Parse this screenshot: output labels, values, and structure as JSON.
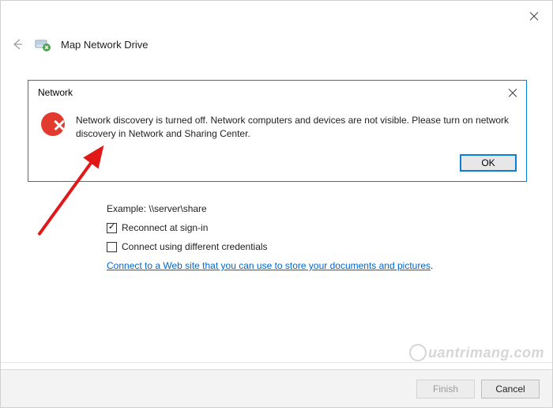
{
  "window": {
    "title": "Map Network Drive"
  },
  "wizard": {
    "example_label": "Example: \\\\server\\share",
    "reconnect_label": "Reconnect at sign-in",
    "reconnect_checked": true,
    "diff_creds_label": "Connect using different credentials",
    "diff_creds_checked": false,
    "link_text": "Connect to a Web site that you can use to store your documents and pictures",
    "link_trailer": "."
  },
  "modal": {
    "title": "Network",
    "message": "Network discovery is turned off. Network computers and devices are not visible. Please turn on network discovery in Network and Sharing Center.",
    "ok_label": "OK"
  },
  "buttons": {
    "finish": "Finish",
    "cancel": "Cancel"
  },
  "watermark": {
    "text": "uantrimang.com"
  }
}
